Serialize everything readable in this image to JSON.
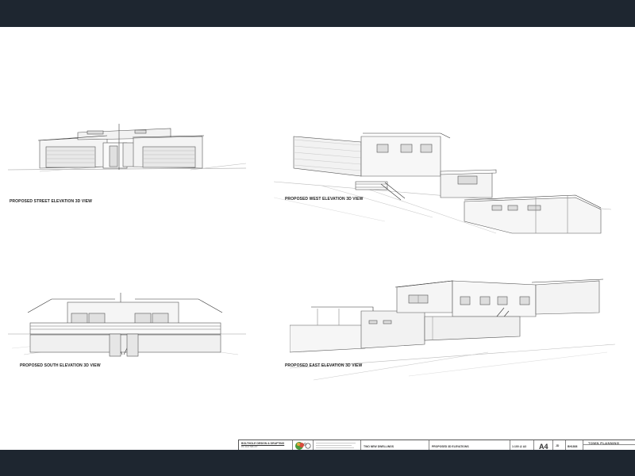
{
  "views": {
    "street": {
      "caption": "PROPOSED STREET ELEVATION 3D VIEW"
    },
    "west": {
      "caption": "PROPOSED WEST ELEVATION 3D VIEW"
    },
    "south": {
      "caption": "PROPOSED SOUTH ELEVATION 3D VIEW"
    },
    "east": {
      "caption": "PROPOSED EAST ELEVATION 3D VIEW"
    }
  },
  "title_block": {
    "company": "BOLTHOLE DESIGN & DRAFTING",
    "company_phone": "Ph: 0417 595 477",
    "copyright_symbol": "©",
    "project": "TWO NEW DWELLINGS",
    "drawing_title": "PROPOSED 3D ELEVATIONS",
    "scale": "1:100 @ A3",
    "drawn_by": "JD",
    "sheet_no": "A4",
    "job_no": "BH1808",
    "stage": "TOWN PLANNING"
  }
}
